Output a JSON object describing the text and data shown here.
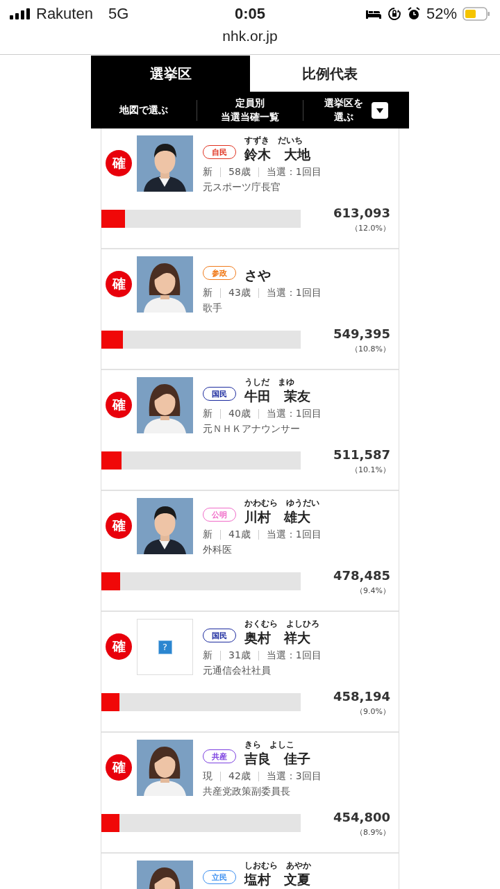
{
  "status_bar": {
    "carrier": "Rakuten",
    "network": "5G",
    "time": "0:05",
    "battery": "52%"
  },
  "address_bar": {
    "url": "nhk.or.jp"
  },
  "tabs": [
    {
      "label": "選挙区",
      "selected": true
    },
    {
      "label": "比例代表",
      "selected": false
    }
  ],
  "subnav": [
    {
      "lines": [
        "地図で選ぶ"
      ],
      "kind": "link"
    },
    {
      "lines": [
        "定員別",
        "当選当確一覧"
      ],
      "kind": "link"
    },
    {
      "lines": [
        "選挙区を",
        "選ぶ"
      ],
      "kind": "dropdown"
    }
  ],
  "candidates": [
    {
      "result": "確",
      "party": "自民",
      "color": "#e0301e",
      "reading": "すずき　だいち",
      "name": "鈴木　大地",
      "status": "新",
      "age": "58歳",
      "wins": "当選：1回目",
      "career": "元スポーツ庁長官",
      "votes": "613,093",
      "share": "（12.0%）",
      "level": 0.12
    },
    {
      "result": "確",
      "party": "参政",
      "color": "#f07a1a",
      "name": "さや",
      "status": "新",
      "age": "43歳",
      "wins": "当選：1回目",
      "career": "歌手",
      "votes": "549,395",
      "share": "（10.8%）",
      "level": 0.108
    },
    {
      "result": "確",
      "party": "国民",
      "color": "#1b2a9e",
      "reading": "うしだ　まゆ",
      "name": "牛田　茉友",
      "status": "新",
      "age": "40歳",
      "wins": "当選：1回目",
      "career": "元ＮＨＫアナウンサー",
      "votes": "511,587",
      "share": "（10.1%）",
      "level": 0.101
    },
    {
      "result": "確",
      "party": "公明",
      "color": "#f06cc8",
      "reading": "かわむら　ゆうだい",
      "name": "川村　雄大",
      "status": "新",
      "age": "41歳",
      "wins": "当選：1回目",
      "career": "外科医",
      "votes": "478,485",
      "share": "（9.4%）",
      "level": 0.094
    },
    {
      "result": "確",
      "party": "国民",
      "color": "#1b2a9e",
      "reading": "おくむら　よしひろ",
      "name": "奥村　祥大",
      "status": "新",
      "age": "31歳",
      "wins": "当選：1回目",
      "career": "元通信会社社員",
      "votes": "458,194",
      "share": "（9.0%）",
      "level": 0.09,
      "photo": {
        "kind": "missing",
        "mark": "?"
      }
    },
    {
      "result": "確",
      "party": "共産",
      "color": "#7b3fe0",
      "reading": "きら　よしこ",
      "name": "吉良　佳子",
      "status": "現",
      "age": "42歳",
      "wins": "当選：3回目",
      "career": "共産党政策副委員長",
      "votes": "454,800",
      "share": "（8.9%）",
      "level": 0.089
    },
    {
      "party": "立民",
      "color": "#3a8ef0",
      "reading": "しおむら　あやか",
      "name": "塩村　文夏"
    }
  ]
}
